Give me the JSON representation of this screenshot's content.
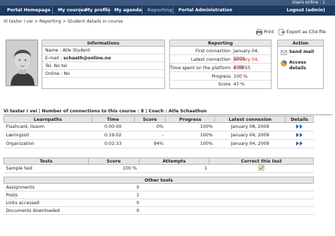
{
  "topbar": {
    "users_online": "Users online : 1"
  },
  "nav": [
    {
      "label": "Portal Homepage",
      "name": "nav-portal-homepage",
      "disabled": false
    },
    {
      "label": "My courses",
      "name": "nav-my-courses",
      "disabled": false
    },
    {
      "label": "My profile",
      "name": "nav-my-profile",
      "disabled": false
    },
    {
      "label": "My agenda",
      "name": "nav-my-agenda",
      "disabled": false
    },
    {
      "label": "Reporting",
      "name": "nav-reporting",
      "disabled": true
    },
    {
      "label": "Portal Administration",
      "name": "nav-portal-administration",
      "disabled": false
    }
  ],
  "logout": "Logout (admin)",
  "breadcrumb": "Vi tester i vei > Reporting > Student details in course",
  "actions_top": {
    "print": "Print",
    "export": "Export as CSV-file"
  },
  "informations": {
    "title": "Informations",
    "name": "Name : Atle Student",
    "email_label": "E-mail : ",
    "email_value": "schaath@online.no",
    "tel": "Tel. No tel",
    "online": "Online : No"
  },
  "reporting": {
    "title": "Reporting",
    "rows": [
      {
        "label": "First connection",
        "value": "January 04, 2009",
        "red": false
      },
      {
        "label": "Latest connection",
        "value": "January 04, 2009",
        "red": true
      },
      {
        "label": "Time spent on the platform",
        "value": "6:09:55",
        "red": false
      },
      {
        "label": "Progress",
        "value": "100 %",
        "red": false
      },
      {
        "label": "Score",
        "value": "47 %",
        "red": false
      }
    ]
  },
  "action": {
    "title": "Action",
    "send_mail": "Send mail",
    "access_details": "Access details"
  },
  "course_summary": "Vi tester i vei | Number of connections to this course : 8  |  Coach : Atle Schaathun",
  "learnpaths": {
    "headers": [
      "Learnpaths",
      "Time",
      "Score",
      "Progress",
      "Latest connexion",
      "Details"
    ],
    "rows": [
      {
        "name": "Flashcard, lissom",
        "time": "0:00:00",
        "score": "0%",
        "progress": "100%",
        "latest": "January 08, 2009"
      },
      {
        "name": "Læringssti",
        "time": "0:19:02",
        "score": "-",
        "progress": "100%",
        "latest": "January 04, 2009"
      },
      {
        "name": "Organization",
        "time": "0:02:33",
        "score": "94%",
        "progress": "100%",
        "latest": "January 04, 2009"
      }
    ]
  },
  "tests": {
    "headers": [
      "Tests",
      "Score",
      "Attempts",
      "Correct this test"
    ],
    "rows": [
      {
        "name": "Sample test",
        "score": "100 %",
        "attempts": "1"
      }
    ]
  },
  "other_tools": {
    "title": "Other tools",
    "rows": [
      {
        "label": "Assignments",
        "value": "0"
      },
      {
        "label": "Posts",
        "value": "1"
      },
      {
        "label": "Links accessed",
        "value": "0"
      },
      {
        "label": "Documents downloaded",
        "value": "0"
      }
    ]
  }
}
